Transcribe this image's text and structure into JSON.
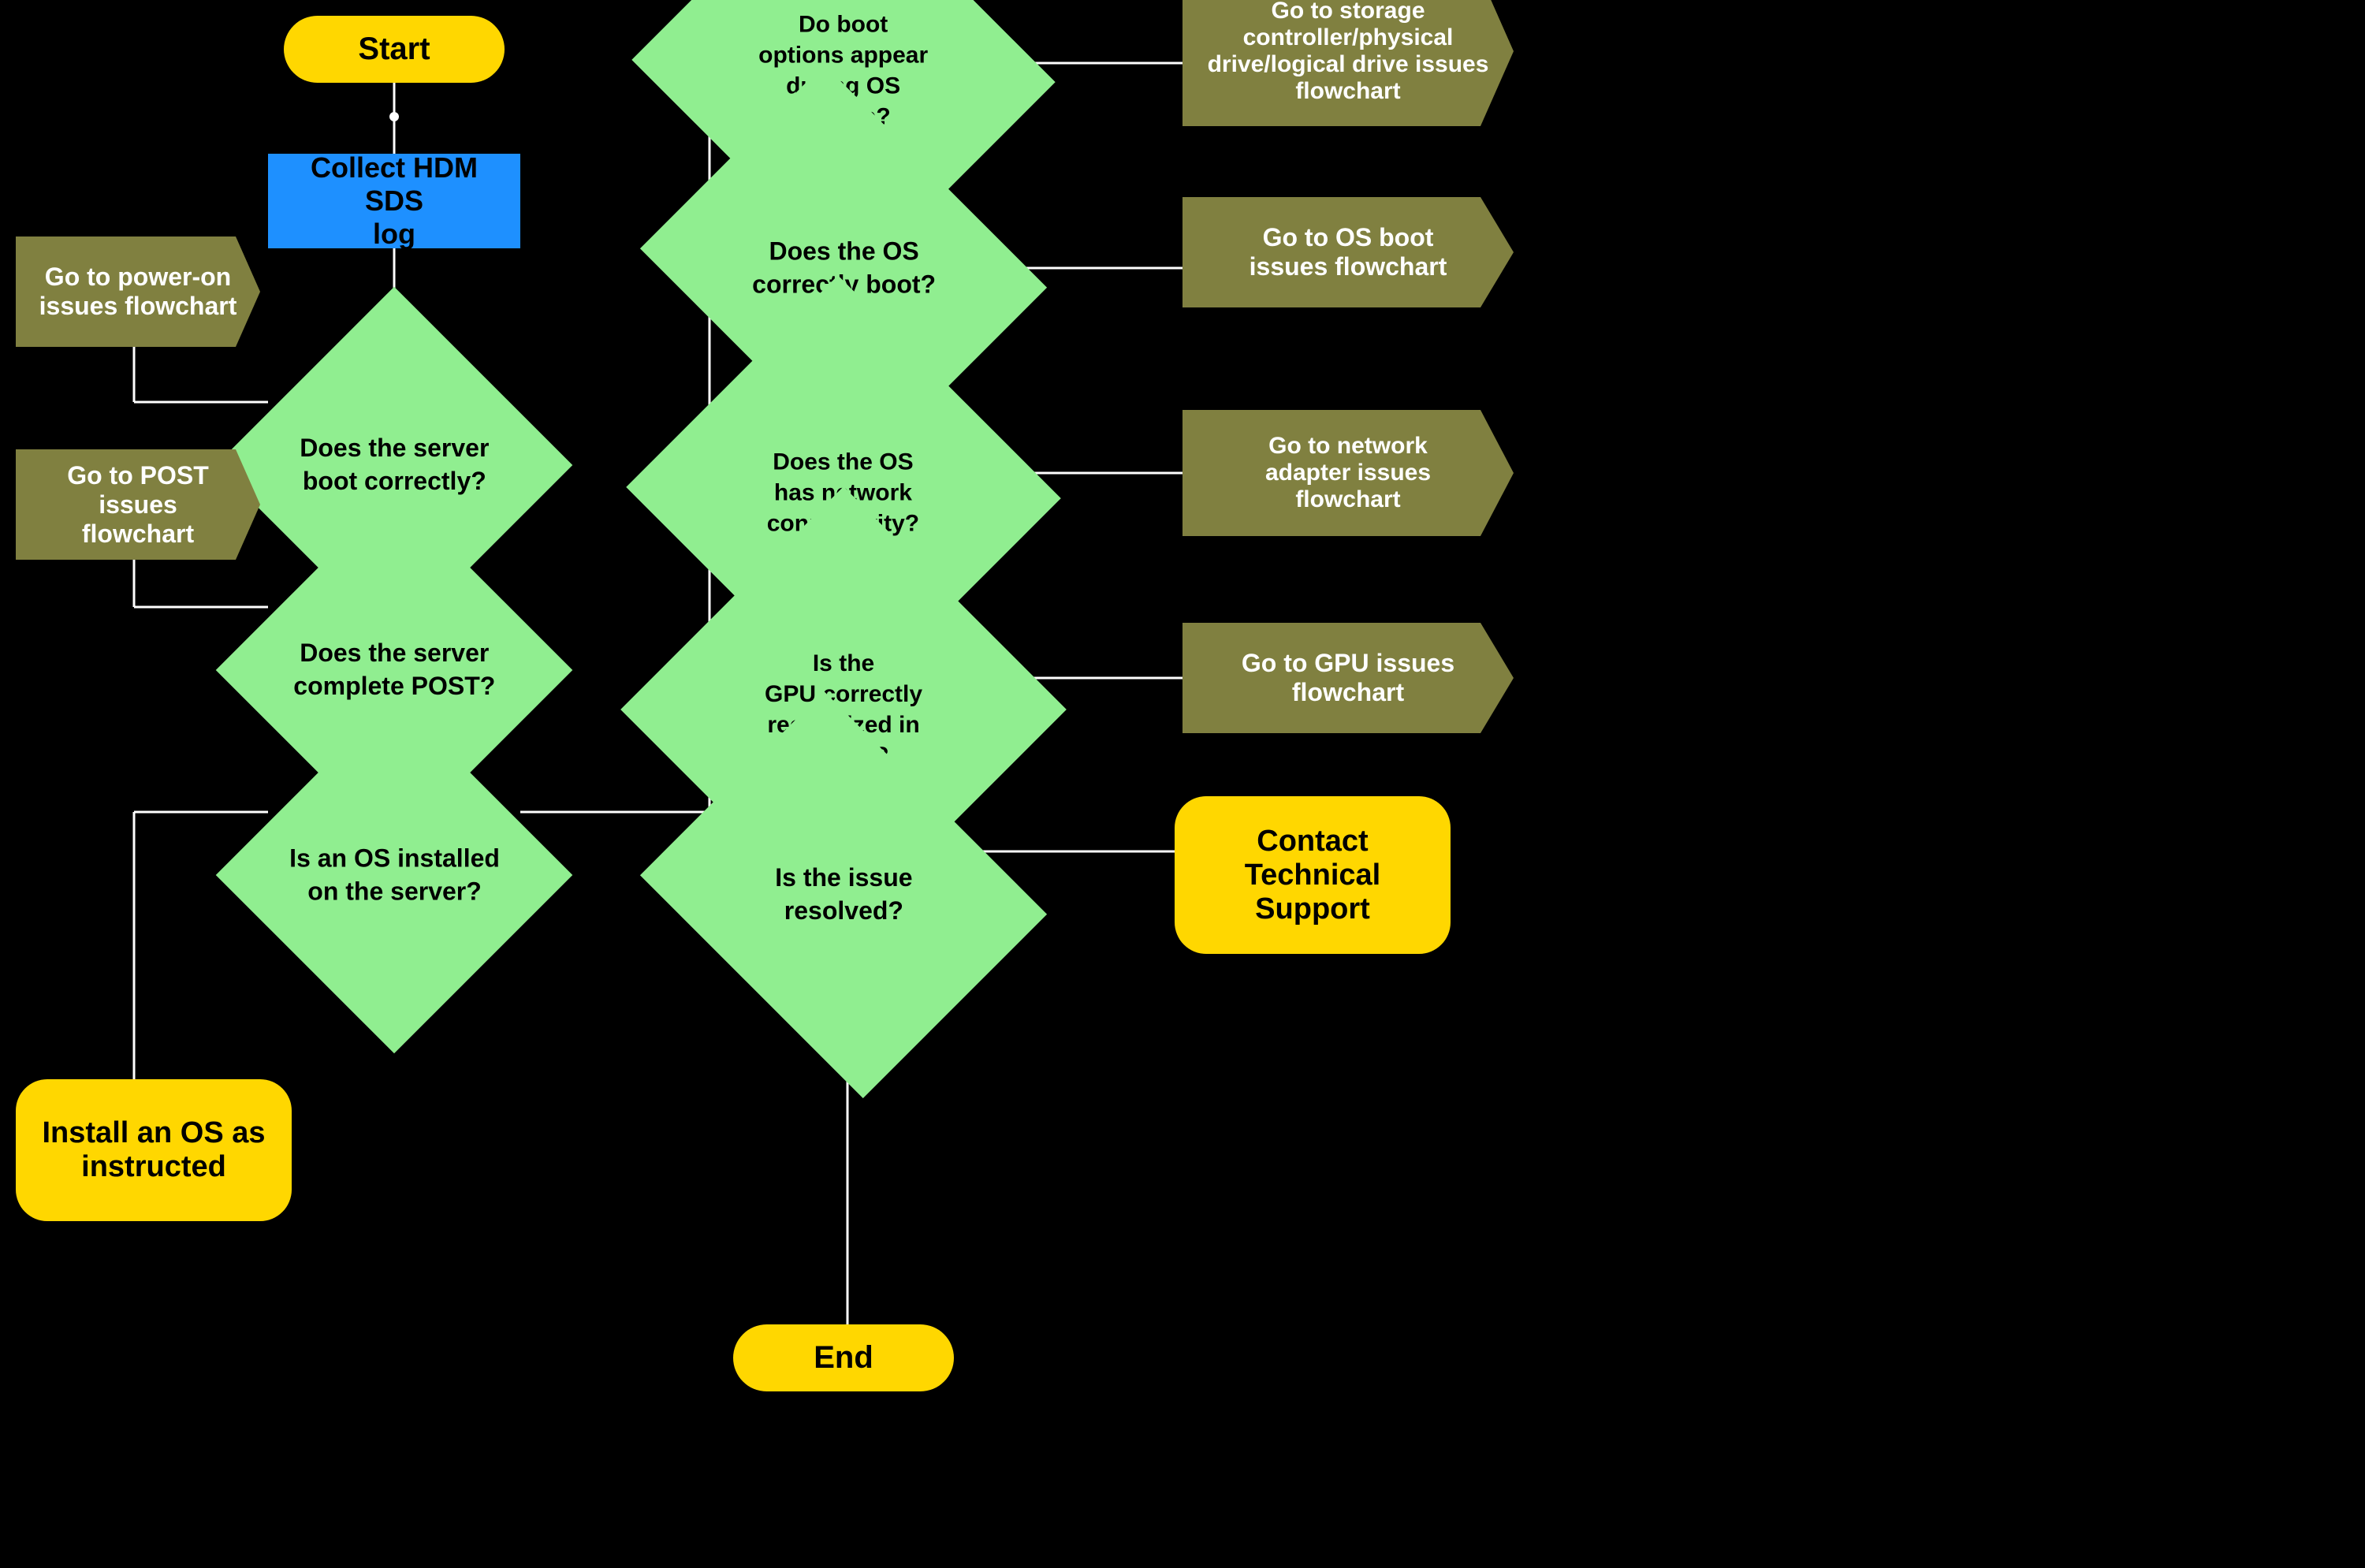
{
  "nodes": {
    "start": {
      "label": "Start"
    },
    "collect_log": {
      "label": "Collect HDM SDS\nlog"
    },
    "boot_correctly": {
      "label": "Does the server\nboot correctly?"
    },
    "complete_post": {
      "label": "Does the server\ncomplete POST?"
    },
    "os_installed": {
      "label": "Is an OS installed\non the server?"
    },
    "boot_options": {
      "label": "Do boot\noptions appear\nduring OS\nstartup?"
    },
    "os_boot": {
      "label": "Does the OS\ncorrectly boot?"
    },
    "network_connectivity": {
      "label": "Does the OS\nhas network\nconnectivity?"
    },
    "gpu_recognized": {
      "label": "Is the\nGPU correctly\nrecognized in\nthe OS?"
    },
    "issue_resolved": {
      "label": "Is the issue\nresolved?"
    },
    "end": {
      "label": "End"
    },
    "install_os": {
      "label": "Install an OS as\ninstructed"
    },
    "power_on": {
      "label": "Go to power-on\nissues flowchart"
    },
    "post_issues": {
      "label": "Go to POST issues\nflowchart"
    },
    "storage_issues": {
      "label": "Go to storage\ncontroller/physical\ndrive/logical drive issues\nflowchart"
    },
    "os_boot_issues": {
      "label": "Go to OS boot\nissues flowchart"
    },
    "network_issues": {
      "label": "Go to network\nadapter issues\nflowchart"
    },
    "gpu_issues": {
      "label": "Go to GPU issues\nflowchart"
    },
    "contact_support": {
      "label": "Contact\nTechnical\nSupport"
    }
  }
}
